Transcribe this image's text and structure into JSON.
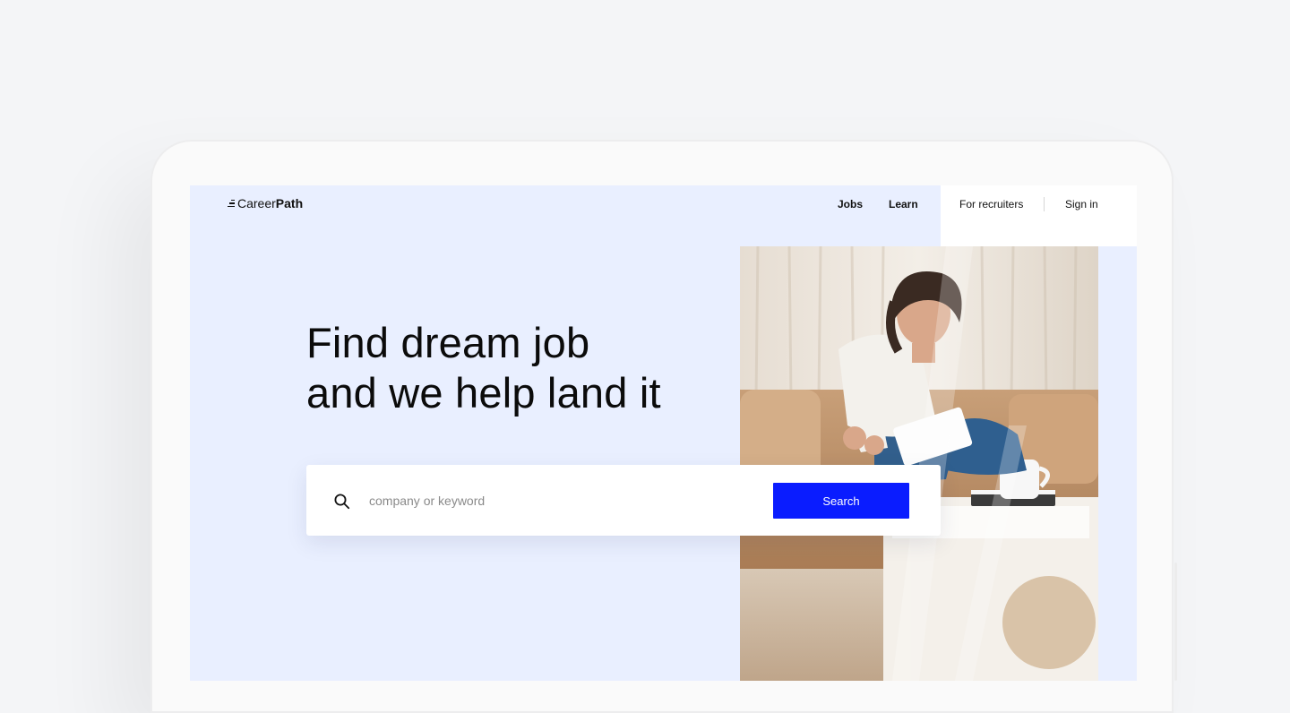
{
  "brand": {
    "name_light": "Career",
    "name_bold": "Path"
  },
  "nav": {
    "jobs": "Jobs",
    "learn": "Learn",
    "recruiters": "For recruiters",
    "sign_in": "Sign in"
  },
  "hero": {
    "line1": "Find dream job",
    "line2": "and we help land it"
  },
  "search": {
    "icon": "search-icon",
    "placeholder": "company or keyword",
    "button_label": "Search"
  },
  "colors": {
    "screen_background": "#e9efff",
    "accent": "#0a1cff"
  }
}
